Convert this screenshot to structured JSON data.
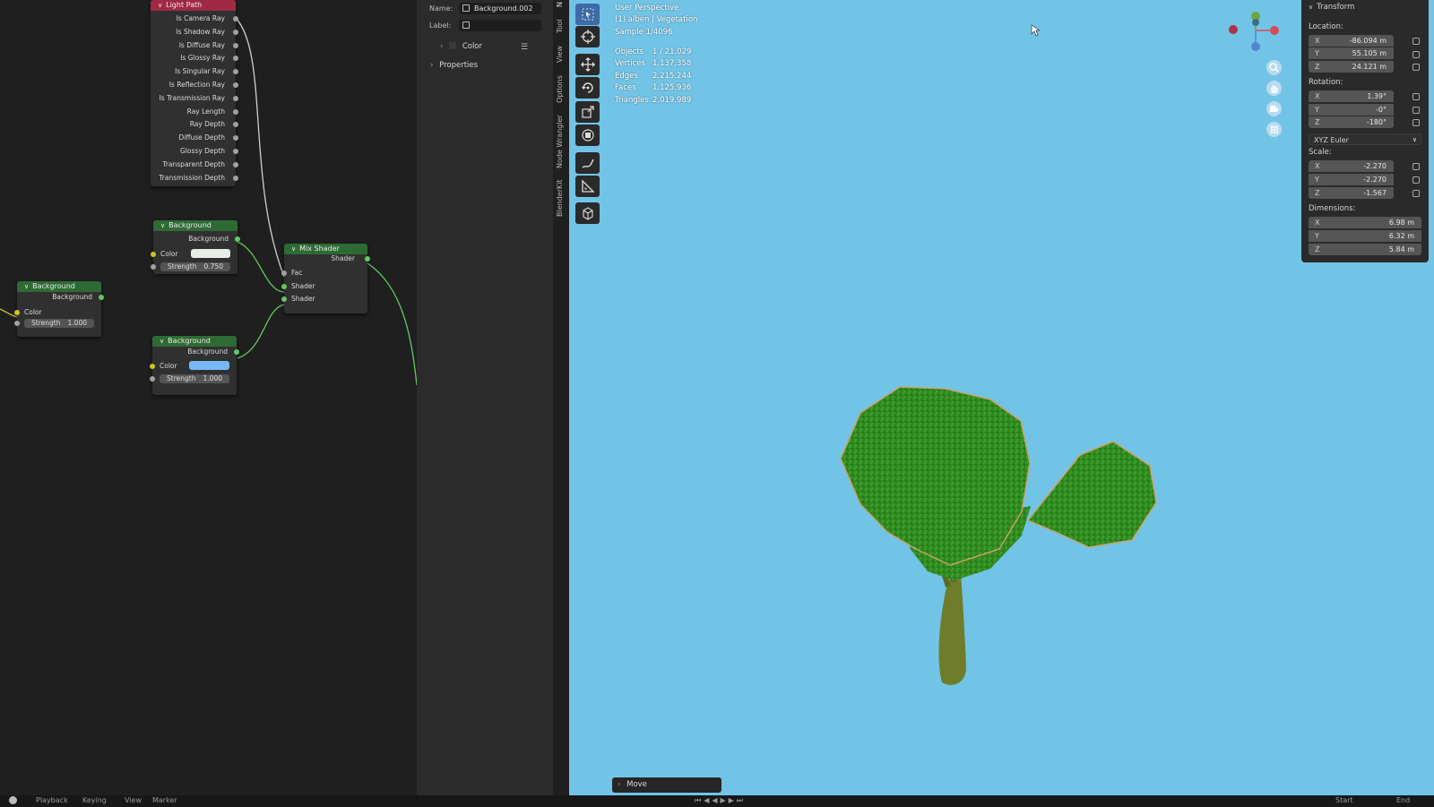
{
  "node_editor": {
    "light_path": {
      "title": "Light Path",
      "outputs": [
        "Is Camera Ray",
        "Is Shadow Ray",
        "Is Diffuse Ray",
        "Is Glossy Ray",
        "Is Singular Ray",
        "Is Reflection Ray",
        "Is Transmission Ray",
        "Ray Length",
        "Ray Depth",
        "Diffuse Depth",
        "Glossy Depth",
        "Transparent Depth",
        "Transmission Depth"
      ]
    },
    "bg_top": {
      "title": "Background",
      "output": "Background",
      "color_label": "Color",
      "strength_label": "Strength",
      "strength_value": "0.750",
      "swatch_color": "#e6ece6"
    },
    "bg_left": {
      "title": "Background",
      "output": "Background",
      "color_label": "Color",
      "strength_label": "Strength",
      "strength_value": "1.000"
    },
    "bg_bottom": {
      "title": "Background",
      "output": "Background",
      "color_label": "Color",
      "strength_label": "Strength",
      "strength_value": "1.000",
      "swatch_color": "#76b9f4"
    },
    "mix_shader": {
      "title": "Mix Shader",
      "output": "Shader",
      "inputs": [
        "Fac",
        "Shader",
        "Shader"
      ]
    }
  },
  "sidebar": {
    "name_label": "Name:",
    "name_value": "Background.002",
    "label_label": "Label:",
    "label_value": "",
    "color_row": "Color",
    "properties_row": "Properties",
    "vertical_tabs": [
      "Tool",
      "View",
      "Options",
      "Node Wrangler",
      "BlenderKit"
    ],
    "tab_n": "N"
  },
  "viewport": {
    "perspective": "User Perspective",
    "collection": "(1) alben | Vegetation",
    "sample": "Sample 1/4096",
    "stats": [
      {
        "label": "Objects",
        "value": "1 / 21,029"
      },
      {
        "label": "Vertices",
        "value": "1,137,358"
      },
      {
        "label": "Edges",
        "value": "2,215,244"
      },
      {
        "label": "Faces",
        "value": "1,125,936"
      },
      {
        "label": "Triangles",
        "value": "2,019,989"
      }
    ],
    "move_panel": "Move"
  },
  "transform": {
    "title": "Transform",
    "location_label": "Location:",
    "location": [
      {
        "axis": "X",
        "value": "-86.094 m"
      },
      {
        "axis": "Y",
        "value": "55.105 m"
      },
      {
        "axis": "Z",
        "value": "24.121 m"
      }
    ],
    "rotation_label": "Rotation:",
    "rotation": [
      {
        "axis": "X",
        "value": "1.39°"
      },
      {
        "axis": "Y",
        "value": "-0°"
      },
      {
        "axis": "Z",
        "value": "-180°"
      }
    ],
    "rotation_mode": "XYZ Euler",
    "scale_label": "Scale:",
    "scale": [
      {
        "axis": "X",
        "value": "-2.270"
      },
      {
        "axis": "Y",
        "value": "-2.270"
      },
      {
        "axis": "Z",
        "value": "-1.567"
      }
    ],
    "dimensions_label": "Dimensions:",
    "dimensions": [
      {
        "axis": "X",
        "value": "6.98 m"
      },
      {
        "axis": "Y",
        "value": "6.32 m"
      },
      {
        "axis": "Z",
        "value": "5.84 m"
      }
    ]
  },
  "statusbar": {
    "items": [
      "Playback",
      "Keying",
      "View",
      "Marker"
    ],
    "right_items": [
      "Start",
      "End"
    ]
  },
  "colors": {
    "viewport_bg": "#72c4e7",
    "node_green": "#2e6b34",
    "node_red": "#a02943",
    "socket_green": "#63c763",
    "socket_yellow": "#c7c729"
  }
}
